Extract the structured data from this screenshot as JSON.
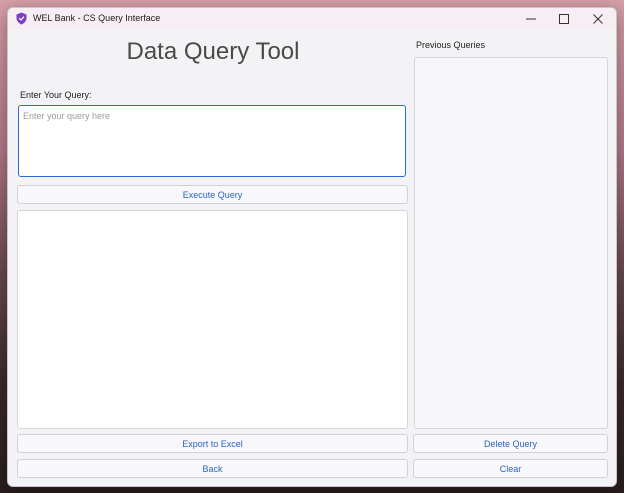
{
  "window": {
    "title": "WEL Bank - CS Query Interface",
    "icon": "shield-icon"
  },
  "controls": {
    "minimize": "minimize-icon",
    "maximize": "maximize-icon",
    "close": "close-icon"
  },
  "main": {
    "heading": "Data Query Tool",
    "query_label": "Enter Your Query:",
    "query_placeholder": "Enter your query here",
    "query_value": "",
    "execute_label": "Execute Query",
    "export_label": "Export to Excel",
    "back_label": "Back"
  },
  "sidebar": {
    "title": "Previous Queries",
    "items": [],
    "delete_label": "Delete Query",
    "clear_label": "Clear"
  },
  "colors": {
    "accent": "#2a64c4",
    "icon_purple": "#7a3fc2"
  }
}
